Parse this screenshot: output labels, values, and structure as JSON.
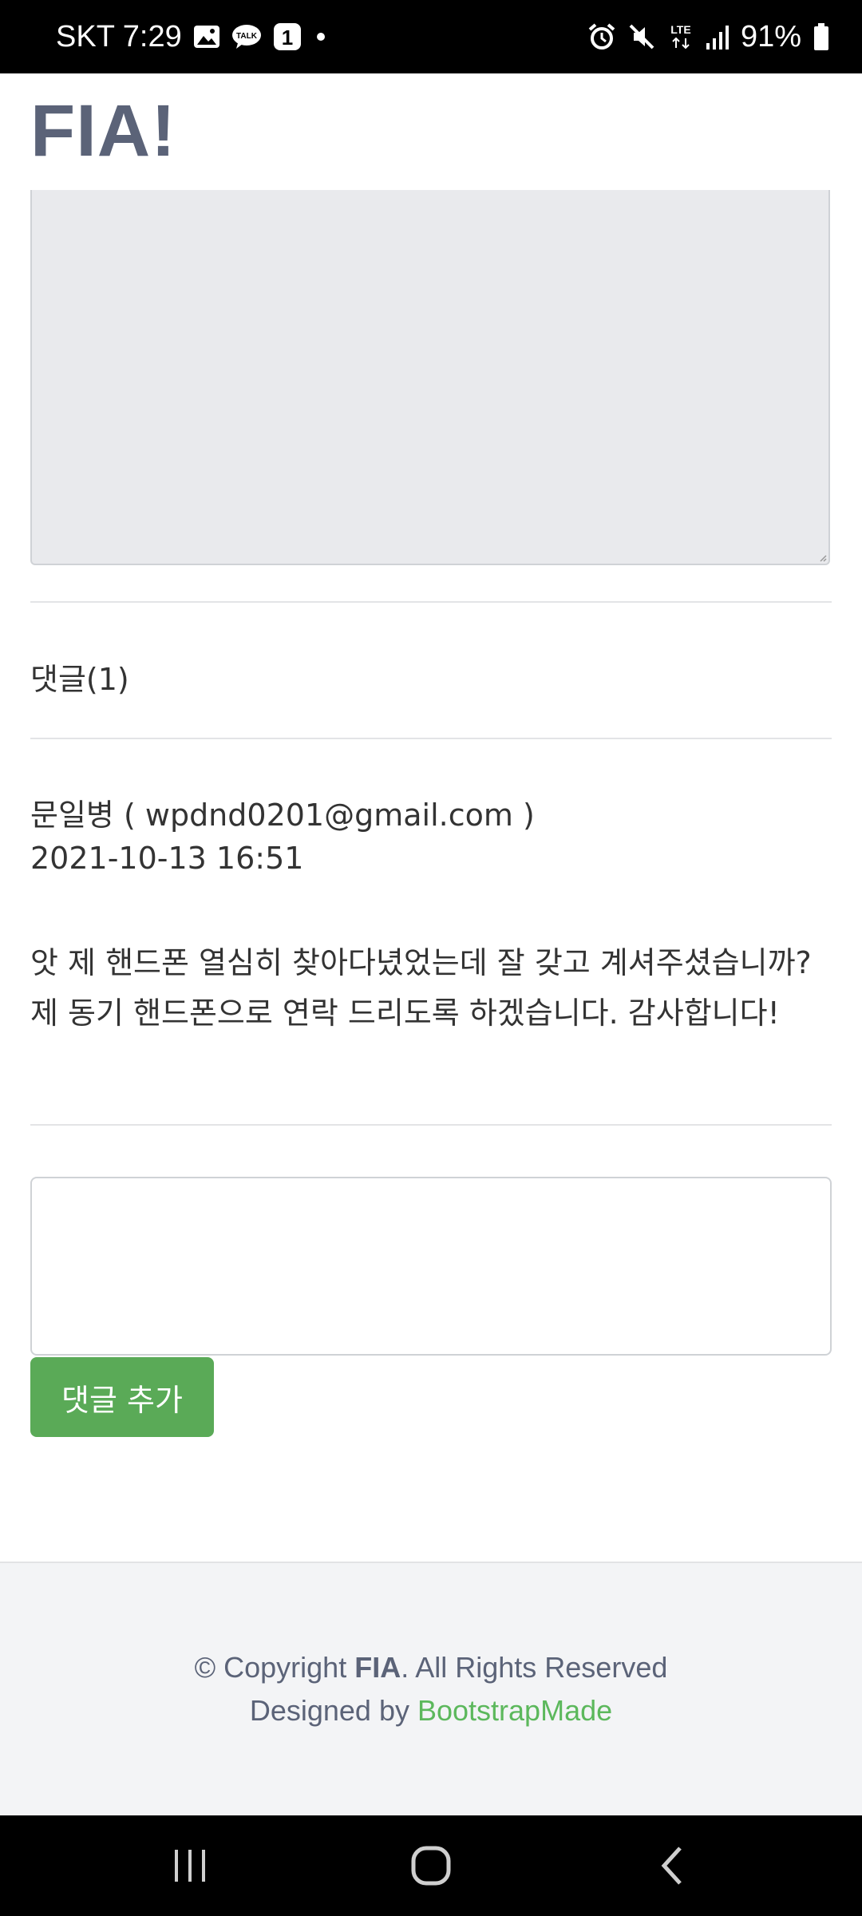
{
  "status_bar": {
    "carrier_time": "SKT 7:29",
    "battery": "91%",
    "icons": [
      "gallery-icon",
      "talk-icon",
      "notification-1-icon",
      "dot-icon",
      "alarm-icon",
      "mute-icon",
      "lte-icon",
      "signal-icon",
      "battery-icon"
    ]
  },
  "header": {
    "logo": "FIA!"
  },
  "comments": {
    "title": "댓글(1)",
    "items": [
      {
        "author": "문일병 ( wpdnd0201@gmail.com )",
        "date": "2021-10-13 16:51",
        "body": "앗 제 핸드폰 열심히 찾아다녔었는데 잘 갖고 계셔주셨습니까? 제 동기 핸드폰으로 연락 드리도록 하겠습니다. 감사합니다!"
      }
    ],
    "input_value": "",
    "add_button_label": "댓글 추가"
  },
  "footer": {
    "copyright_prefix": "© Copyright ",
    "brand": "FIA",
    "copyright_suffix": ". All Rights Reserved",
    "designed_by": "Designed by ",
    "designer_link": "BootstrapMade"
  },
  "colors": {
    "logo": "#5b6378",
    "button": "#5aaa57",
    "link": "#5cb85c",
    "footer_bg": "#f3f4f6"
  }
}
